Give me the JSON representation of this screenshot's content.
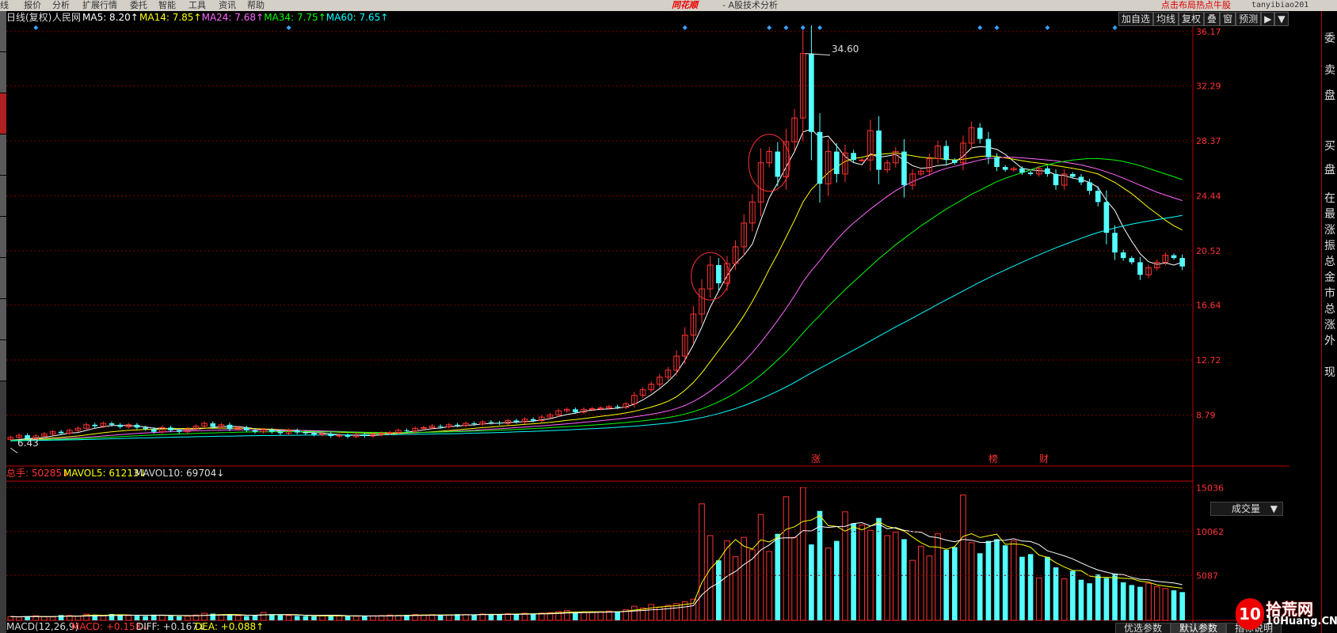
{
  "menu": {
    "items": [
      "线",
      "报价",
      "分析",
      "扩展行情",
      "委托",
      "智能",
      "工具",
      "资讯",
      "帮助"
    ],
    "brand": "同花顺",
    "app_title": "- A股技术分析",
    "promo": "点击布局热点牛股",
    "user": "tanyibiao201"
  },
  "chart_header": {
    "period": "日线(复权)",
    "stock": "人民网",
    "ma": [
      {
        "label": "MA5: 8.20↑",
        "color": "#ffffff"
      },
      {
        "label": "MA14: 7.85↑",
        "color": "#ffff00"
      },
      {
        "label": "MA24: 7.68↑",
        "color": "#ff66ff"
      },
      {
        "label": "MA34: 7.75↑",
        "color": "#00ff00"
      },
      {
        "label": "MA60: 7.65↑",
        "color": "#00ffff"
      }
    ]
  },
  "toolbar": {
    "buttons": [
      "加自选",
      "均线",
      "复权",
      "叠",
      "窗",
      "预测",
      "▶",
      "▼"
    ]
  },
  "right_panel": {
    "chars": [
      "委",
      "卖",
      "盘",
      "买",
      "盘",
      "在",
      "最",
      "涨",
      "振",
      "总",
      "金",
      "市",
      "总",
      "涨",
      "外",
      "现"
    ]
  },
  "event_markers": {
    "labels": [
      "涨",
      "榜",
      "财"
    ]
  },
  "annotations": {
    "high": "34.60",
    "low": "6.43"
  },
  "volume_header": {
    "total": "总手: 50285↓",
    "mavol5": "MAVOL5: 61213↓",
    "mavol10": "MAVOL10: 69704↓",
    "select": "成交量"
  },
  "macd_header": {
    "title": "MACD(12,26,9)",
    "macd": "MACD: +0.158↓",
    "diff": "DIFF: +0.167↓",
    "dea": "DEA: +0.088↑"
  },
  "bottom_tabs": [
    "优选参数",
    "默认参数",
    "指标说明"
  ],
  "watermark": {
    "logo": "10",
    "name": "拾荒网",
    "domain": "10Huang.CN"
  },
  "colors": {
    "up": "#ff3232",
    "down": "#54ffff",
    "grid": "#7a0000",
    "axis": "#ff3232"
  },
  "chart_data": {
    "type": "candlestick",
    "price_axis": {
      "ticks": [
        36.17,
        32.29,
        28.37,
        24.44,
        20.52,
        16.64,
        12.72,
        8.79
      ],
      "range": [
        6.0,
        36.5
      ]
    },
    "volume_axis": {
      "ticks": [
        15036,
        10062,
        5087
      ],
      "range": [
        0,
        15600
      ]
    },
    "annotations": {
      "high": 34.6,
      "low": 6.43
    },
    "series": {
      "close": [
        7.2,
        7.35,
        7.1,
        7.3,
        7.45,
        7.6,
        7.5,
        7.7,
        7.85,
        8.1,
        8.0,
        8.2,
        8.1,
        7.95,
        8.1,
        7.9,
        7.8,
        7.6,
        7.9,
        7.7,
        7.6,
        7.8,
        8.0,
        8.2,
        7.95,
        8.1,
        7.8,
        7.9,
        7.7,
        7.6,
        7.75,
        7.6,
        7.5,
        7.7,
        7.55,
        7.5,
        7.4,
        7.45,
        7.3,
        7.35,
        7.25,
        7.4,
        7.3,
        7.4,
        7.5,
        7.55,
        7.7,
        7.65,
        7.85,
        7.9,
        8.0,
        7.95,
        8.1,
        8.05,
        8.2,
        8.15,
        8.3,
        8.25,
        8.2,
        8.4,
        8.3,
        8.5,
        8.4,
        8.65,
        8.8,
        9.1,
        9.2,
        9.0,
        9.2,
        9.25,
        9.3,
        9.4,
        9.35,
        9.6,
        10.2,
        10.6,
        11.0,
        11.5,
        12.0,
        13.0,
        14.5,
        16.0,
        17.8,
        19.5,
        18.2,
        19.6,
        20.8,
        22.5,
        24.0,
        26.8,
        27.6,
        25.8,
        28.3,
        30.0,
        34.6,
        29.0,
        25.3,
        27.6,
        26.0,
        27.5,
        27.0,
        27.0,
        29.1,
        26.3,
        26.8,
        27.6,
        25.2,
        26.0,
        26.2,
        27.1,
        28.0,
        27.0,
        26.8,
        28.2,
        29.3,
        28.5,
        27.2,
        26.5,
        26.3,
        26.4,
        26.1,
        26.0,
        26.4,
        26.0,
        25.2,
        26.0,
        25.8,
        25.4,
        24.8,
        24.0,
        21.8,
        20.4,
        20.0,
        19.7,
        18.8,
        19.3,
        19.7,
        20.2,
        20.0,
        19.4
      ],
      "ma5": [
        7.0,
        7.05,
        7.1,
        7.15,
        7.2,
        7.3,
        7.4,
        7.5,
        7.55,
        7.7,
        7.85,
        7.95,
        8.05,
        8.05,
        8.05,
        8.0,
        7.95,
        7.85,
        7.85,
        7.8,
        7.75,
        7.75,
        7.78,
        7.85,
        7.9,
        7.97,
        7.99,
        7.97,
        7.9,
        7.82,
        7.75,
        7.72,
        7.65,
        7.63,
        7.62,
        7.56,
        7.53,
        7.52,
        7.44,
        7.4,
        7.35,
        7.35,
        7.33,
        7.34,
        7.37,
        7.42,
        7.49,
        7.56,
        7.65,
        7.73,
        7.82,
        7.87,
        7.96,
        8.0,
        8.06,
        8.09,
        8.16,
        8.19,
        8.22,
        8.26,
        8.29,
        8.33,
        8.36,
        8.45,
        8.53,
        8.69,
        8.83,
        8.93,
        9.06,
        9.14,
        9.2,
        9.23,
        9.28,
        9.38,
        9.57,
        9.87,
        10.24,
        10.68,
        11.18,
        11.8,
        12.72,
        13.8,
        15.06,
        16.5,
        17.64,
        18.74,
        19.62,
        20.2,
        21.0,
        22.7,
        24.3,
        25.36,
        26.5,
        27.6,
        29.0,
        29.2,
        28.6,
        28.7,
        28.0,
        27.24,
        26.82,
        26.66,
        27.44,
        27.2,
        27.28,
        27.4,
        26.98,
        26.6,
        26.4,
        26.46,
        26.6,
        26.66,
        26.85,
        27.26,
        27.86,
        27.96,
        27.9,
        27.76,
        27.4,
        26.9,
        26.4,
        26.3,
        26.24,
        26.2,
        25.94,
        25.9,
        25.7,
        25.6,
        25.4,
        25.04,
        24.1,
        23.4,
        22.2,
        21.2,
        20.3,
        19.74,
        19.55,
        19.65,
        19.5,
        19.7
      ],
      "ma14": [
        7.0,
        7.02,
        7.05,
        7.08,
        7.12,
        7.16,
        7.2,
        7.25,
        7.3,
        7.38,
        7.45,
        7.53,
        7.6,
        7.65,
        7.7,
        7.73,
        7.76,
        7.78,
        7.8,
        7.82,
        7.83,
        7.84,
        7.85,
        7.86,
        7.86,
        7.86,
        7.86,
        7.85,
        7.84,
        7.82,
        7.8,
        7.78,
        7.75,
        7.73,
        7.71,
        7.68,
        7.66,
        7.64,
        7.6,
        7.57,
        7.55,
        7.53,
        7.5,
        7.48,
        7.47,
        7.47,
        7.48,
        7.5,
        7.53,
        7.56,
        7.6,
        7.64,
        7.69,
        7.74,
        7.79,
        7.84,
        7.9,
        7.94,
        7.99,
        8.04,
        8.08,
        8.13,
        8.17,
        8.22,
        8.27,
        8.34,
        8.41,
        8.47,
        8.54,
        8.62,
        8.7,
        8.77,
        8.85,
        8.94,
        9.06,
        9.2,
        9.36,
        9.55,
        9.78,
        10.1,
        10.56,
        11.12,
        11.8,
        12.6,
        13.4,
        14.2,
        15.0,
        15.9,
        16.9,
        18.0,
        19.2,
        20.3,
        21.5,
        22.7,
        24.0,
        24.9,
        25.5,
        26.1,
        26.5,
        26.9,
        27.1,
        27.2,
        27.35,
        27.4,
        27.45,
        27.5,
        27.4,
        27.3,
        27.2,
        27.15,
        27.1,
        27.05,
        27.0,
        27.05,
        27.15,
        27.25,
        27.3,
        27.25,
        27.15,
        27.05,
        26.95,
        26.85,
        26.78,
        26.7,
        26.6,
        26.5,
        26.4,
        26.3,
        26.15,
        26.0,
        25.7,
        25.4,
        25.0,
        24.6,
        24.1,
        23.6,
        23.15,
        22.7,
        22.3,
        22.0
      ],
      "ma24": [
        7.0,
        7.01,
        7.02,
        7.04,
        7.06,
        7.08,
        7.11,
        7.14,
        7.17,
        7.21,
        7.25,
        7.3,
        7.35,
        7.4,
        7.44,
        7.48,
        7.52,
        7.55,
        7.58,
        7.61,
        7.63,
        7.65,
        7.67,
        7.69,
        7.71,
        7.72,
        7.73,
        7.74,
        7.74,
        7.74,
        7.74,
        7.73,
        7.72,
        7.71,
        7.7,
        7.69,
        7.67,
        7.66,
        7.64,
        7.62,
        7.6,
        7.58,
        7.56,
        7.55,
        7.54,
        7.53,
        7.53,
        7.53,
        7.54,
        7.55,
        7.57,
        7.59,
        7.62,
        7.65,
        7.68,
        7.71,
        7.75,
        7.78,
        7.82,
        7.86,
        7.9,
        7.94,
        7.98,
        8.02,
        8.07,
        8.12,
        8.17,
        8.22,
        8.28,
        8.33,
        8.39,
        8.45,
        8.51,
        8.58,
        8.66,
        8.75,
        8.85,
        8.96,
        9.09,
        9.26,
        9.48,
        9.76,
        10.1,
        10.5,
        10.96,
        11.46,
        12.0,
        12.6,
        13.25,
        13.97,
        14.75,
        15.55,
        16.4,
        17.3,
        18.3,
        19.1,
        19.8,
        20.6,
        21.3,
        21.95,
        22.5,
        23.0,
        23.5,
        23.95,
        24.4,
        24.8,
        25.15,
        25.45,
        25.7,
        25.95,
        26.2,
        26.4,
        26.55,
        26.7,
        26.85,
        27.0,
        27.1,
        27.15,
        27.2,
        27.2,
        27.15,
        27.1,
        27.05,
        27.0,
        26.95,
        26.85,
        26.75,
        26.65,
        26.5,
        26.35,
        26.15,
        25.95,
        25.7,
        25.45,
        25.2,
        24.95,
        24.7,
        24.5,
        24.3,
        24.1
      ],
      "ma34": [
        7.0,
        7.0,
        7.01,
        7.02,
        7.03,
        7.05,
        7.06,
        7.08,
        7.1,
        7.13,
        7.16,
        7.19,
        7.22,
        7.25,
        7.28,
        7.31,
        7.34,
        7.37,
        7.39,
        7.42,
        7.44,
        7.46,
        7.48,
        7.5,
        7.52,
        7.54,
        7.55,
        7.57,
        7.58,
        7.59,
        7.6,
        7.6,
        7.61,
        7.61,
        7.61,
        7.61,
        7.61,
        7.6,
        7.6,
        7.59,
        7.58,
        7.57,
        7.56,
        7.56,
        7.55,
        7.55,
        7.55,
        7.55,
        7.56,
        7.56,
        7.57,
        7.58,
        7.6,
        7.61,
        7.63,
        7.65,
        7.67,
        7.69,
        7.72,
        7.74,
        7.77,
        7.8,
        7.83,
        7.86,
        7.89,
        7.93,
        7.96,
        8.0,
        8.04,
        8.08,
        8.12,
        8.16,
        8.21,
        8.26,
        8.32,
        8.38,
        8.45,
        8.53,
        8.62,
        8.73,
        8.87,
        9.03,
        9.23,
        9.47,
        9.74,
        10.04,
        10.38,
        10.76,
        11.18,
        11.65,
        12.17,
        12.72,
        13.3,
        13.95,
        14.65,
        15.3,
        15.9,
        16.55,
        17.15,
        17.75,
        18.3,
        18.85,
        19.4,
        19.95,
        20.45,
        20.95,
        21.4,
        21.85,
        22.3,
        22.7,
        23.1,
        23.5,
        23.85,
        24.2,
        24.55,
        24.85,
        25.15,
        25.45,
        25.7,
        25.9,
        26.1,
        26.3,
        26.5,
        26.65,
        26.8,
        26.9,
        27.0,
        27.05,
        27.1,
        27.1,
        27.05,
        27.0,
        26.9,
        26.75,
        26.6,
        26.4,
        26.2,
        26.0,
        25.8,
        25.6
      ],
      "ma60": [
        6.95,
        6.96,
        6.97,
        6.98,
        6.99,
        7.0,
        7.01,
        7.02,
        7.03,
        7.05,
        7.06,
        7.08,
        7.1,
        7.11,
        7.13,
        7.15,
        7.16,
        7.18,
        7.19,
        7.21,
        7.22,
        7.23,
        7.25,
        7.26,
        7.27,
        7.28,
        7.29,
        7.3,
        7.31,
        7.32,
        7.33,
        7.33,
        7.34,
        7.35,
        7.35,
        7.36,
        7.36,
        7.37,
        7.37,
        7.37,
        7.38,
        7.38,
        7.38,
        7.39,
        7.39,
        7.4,
        7.4,
        7.41,
        7.42,
        7.43,
        7.44,
        7.45,
        7.46,
        7.47,
        7.49,
        7.5,
        7.52,
        7.53,
        7.55,
        7.57,
        7.59,
        7.61,
        7.63,
        7.65,
        7.68,
        7.7,
        7.73,
        7.76,
        7.79,
        7.82,
        7.85,
        7.88,
        7.92,
        7.96,
        8.0,
        8.05,
        8.1,
        8.16,
        8.22,
        8.3,
        8.39,
        8.49,
        8.61,
        8.75,
        8.9,
        9.07,
        9.26,
        9.47,
        9.7,
        9.95,
        10.22,
        10.5,
        10.8,
        11.12,
        11.47,
        11.8,
        12.12,
        12.45,
        12.77,
        13.1,
        13.42,
        13.75,
        14.08,
        14.42,
        14.75,
        15.08,
        15.4,
        15.72,
        16.05,
        16.37,
        16.7,
        17.02,
        17.33,
        17.65,
        17.97,
        18.28,
        18.58,
        18.87,
        19.15,
        19.43,
        19.7,
        19.97,
        20.23,
        20.48,
        20.73,
        20.96,
        21.19,
        21.41,
        21.62,
        21.82,
        21.99,
        22.15,
        22.29,
        22.42,
        22.53,
        22.64,
        22.74,
        22.84,
        22.94,
        23.04
      ],
      "volume": [
        420,
        380,
        460,
        510,
        400,
        390,
        600,
        550,
        480,
        700,
        650,
        500,
        720,
        600,
        550,
        520,
        480,
        640,
        580,
        500,
        450,
        470,
        600,
        800,
        760,
        620,
        580,
        520,
        480,
        560,
        900,
        700,
        600,
        540,
        500,
        480,
        460,
        520,
        540,
        500,
        480,
        460,
        500,
        520,
        540,
        600,
        560,
        620,
        660,
        600,
        640,
        580,
        620,
        700,
        660,
        640,
        720,
        680,
        700,
        760,
        720,
        800,
        760,
        820,
        880,
        1000,
        1100,
        900,
        950,
        920,
        980,
        1050,
        1000,
        1200,
        1600,
        1400,
        1800,
        1500,
        1700,
        1900,
        2100,
        2400,
        13200,
        9600,
        6800,
        9000,
        7200,
        9400,
        8000,
        12000,
        7800,
        9800,
        14000,
        9400,
        15036,
        8600,
        12400,
        8200,
        9000,
        12300,
        11000,
        10800,
        10200,
        11600,
        9600,
        10000,
        9200,
        6800,
        8400,
        7300,
        9800,
        8000,
        8300,
        14200,
        8800,
        7600,
        9000,
        9200,
        8500,
        9000,
        7200,
        7500,
        4800,
        7200,
        6000,
        4700,
        5600,
        4600,
        4200,
        5200,
        4800,
        5300,
        4300,
        4000,
        3800,
        4200,
        3800,
        3600,
        3400,
        3200
      ]
    }
  }
}
